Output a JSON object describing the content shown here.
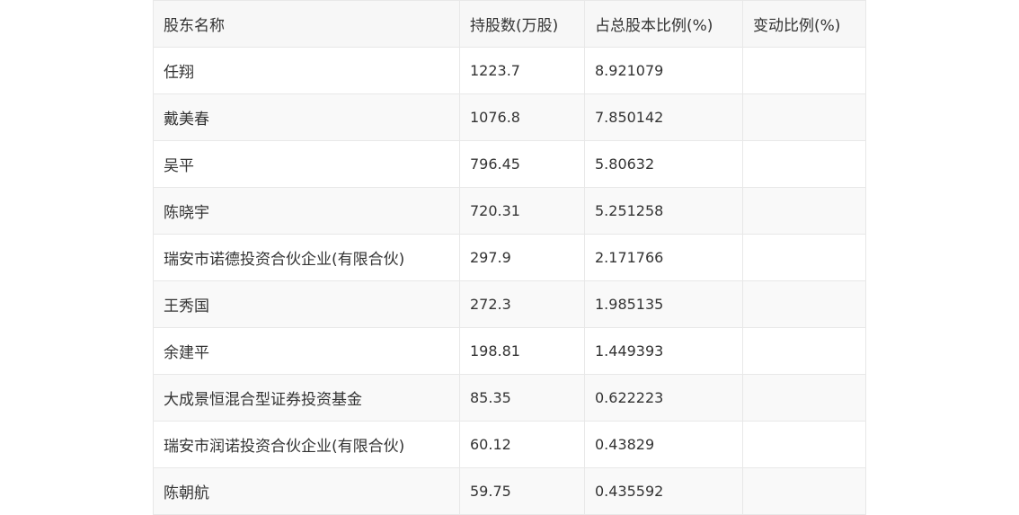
{
  "table": {
    "headers": [
      "股东名称",
      "持股数(万股)",
      "占总股本比例(%)",
      "变动比例(%)"
    ],
    "rows": [
      [
        "任翔",
        "1223.7",
        "8.921079",
        ""
      ],
      [
        "戴美春",
        "1076.8",
        "7.850142",
        ""
      ],
      [
        "吴平",
        "796.45",
        "5.80632",
        ""
      ],
      [
        "陈晓宇",
        "720.31",
        "5.251258",
        ""
      ],
      [
        "瑞安市诺德投资合伙企业(有限合伙)",
        "297.9",
        "2.171766",
        ""
      ],
      [
        "王秀国",
        "272.3",
        "1.985135",
        ""
      ],
      [
        "余建平",
        "198.81",
        "1.449393",
        ""
      ],
      [
        "大成景恒混合型证券投资基金",
        "85.35",
        "0.622223",
        ""
      ],
      [
        "瑞安市润诺投资合伙企业(有限合伙)",
        "60.12",
        "0.43829",
        ""
      ],
      [
        "陈朝航",
        "59.75",
        "0.435592",
        ""
      ]
    ]
  }
}
